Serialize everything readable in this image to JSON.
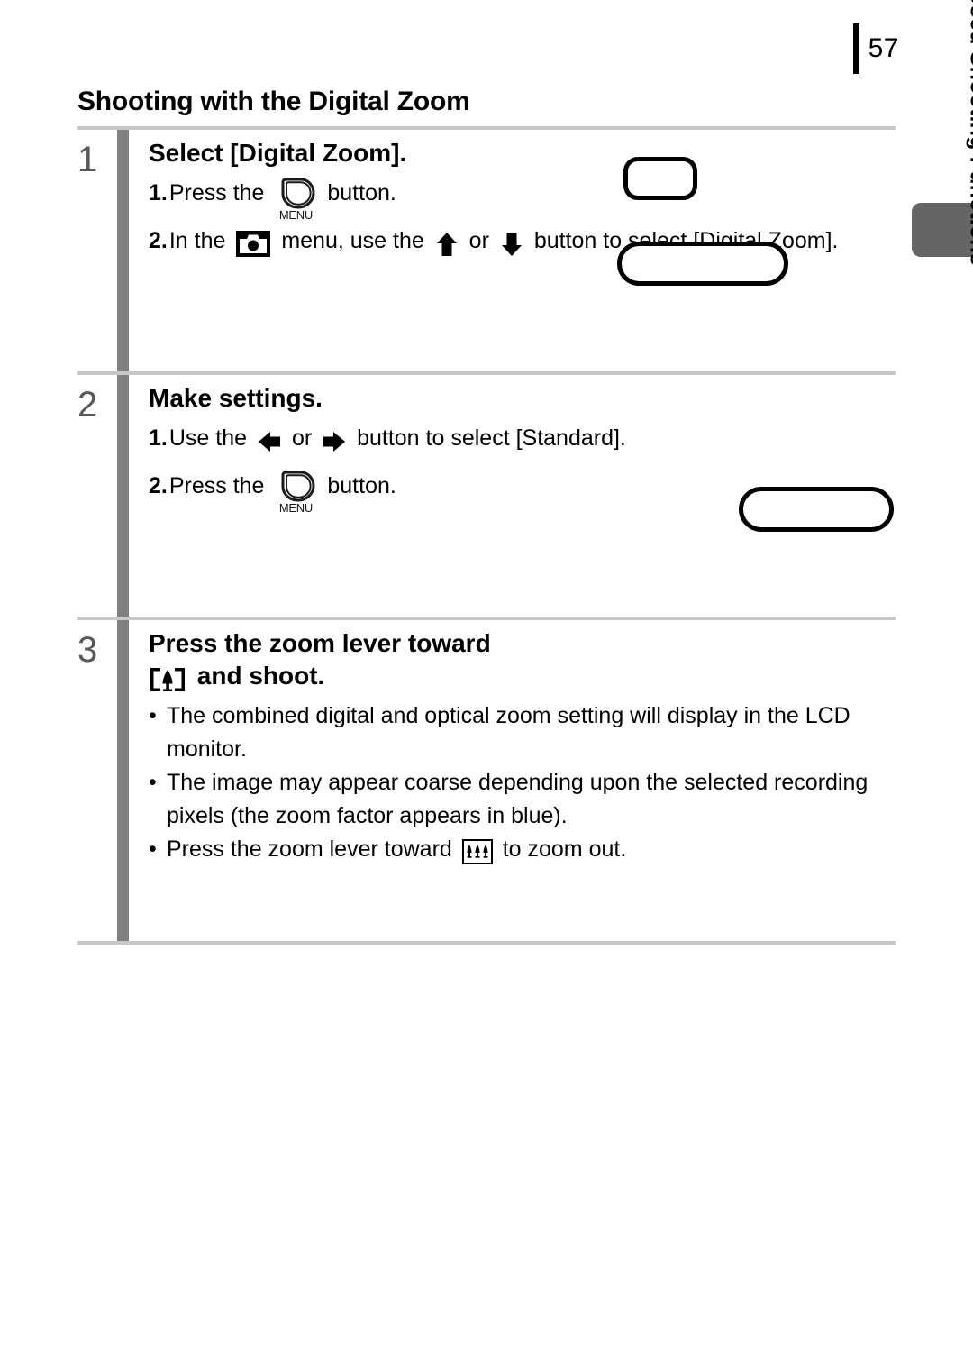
{
  "page": {
    "number": "57",
    "section_heading": "Shooting with the Digital Zoom"
  },
  "side_tab": {
    "label": "Commonly Used Shooting Functions",
    "color": "#656565"
  },
  "steps": [
    {
      "number": "1",
      "title": "Select [Digital Zoom].",
      "sub_steps": [
        {
          "marker": "1.",
          "text_before": "Press the",
          "icon": "menu-button-icon",
          "icon_label": "MENU",
          "text_after": "button."
        },
        {
          "marker": "2.",
          "text_before": "In the",
          "icon": "camera-rec-menu-icon",
          "text_mid": "menu, use the",
          "icon2": "arrow-up-icon",
          "text_mid2": "or",
          "icon3": "arrow-down-icon",
          "text_after": "button to select [Digital Zoom]."
        }
      ],
      "bullets": []
    },
    {
      "number": "2",
      "title": "Make settings.",
      "sub_steps": [
        {
          "marker": "1.",
          "text_before": "Use the",
          "icon": "arrow-left-icon",
          "text_mid": "or",
          "icon2": "arrow-right-icon",
          "text_after": "button to select [Standard]."
        },
        {
          "marker": "2.",
          "text_before": "Press the",
          "icon": "menu-button-icon",
          "icon_label": "MENU",
          "text_after": "button."
        }
      ],
      "bullets": []
    },
    {
      "number": "3",
      "title_line1": "Press the zoom lever toward",
      "title_icon": "telephoto-icon",
      "title_line2": "and shoot.",
      "sub_steps": [],
      "bullets": [
        {
          "text": "The combined digital and optical zoom setting will display in the LCD monitor."
        },
        {
          "text": "The image may appear coarse depending upon the selected recording pixels (the zoom factor appears in blue)."
        },
        {
          "text_before": "Press the zoom lever toward",
          "icon": "wide-angle-icon",
          "text_after": "to zoom out."
        }
      ]
    }
  ],
  "illustrations": [
    {
      "name": "rounded-button-small"
    },
    {
      "name": "rounded-button-wide"
    },
    {
      "name": "rounded-button-wide-2"
    }
  ],
  "colors": {
    "rule": "#c8c8c8",
    "step_bar": "#808080",
    "step_number": "#585858",
    "tab": "#656565"
  }
}
